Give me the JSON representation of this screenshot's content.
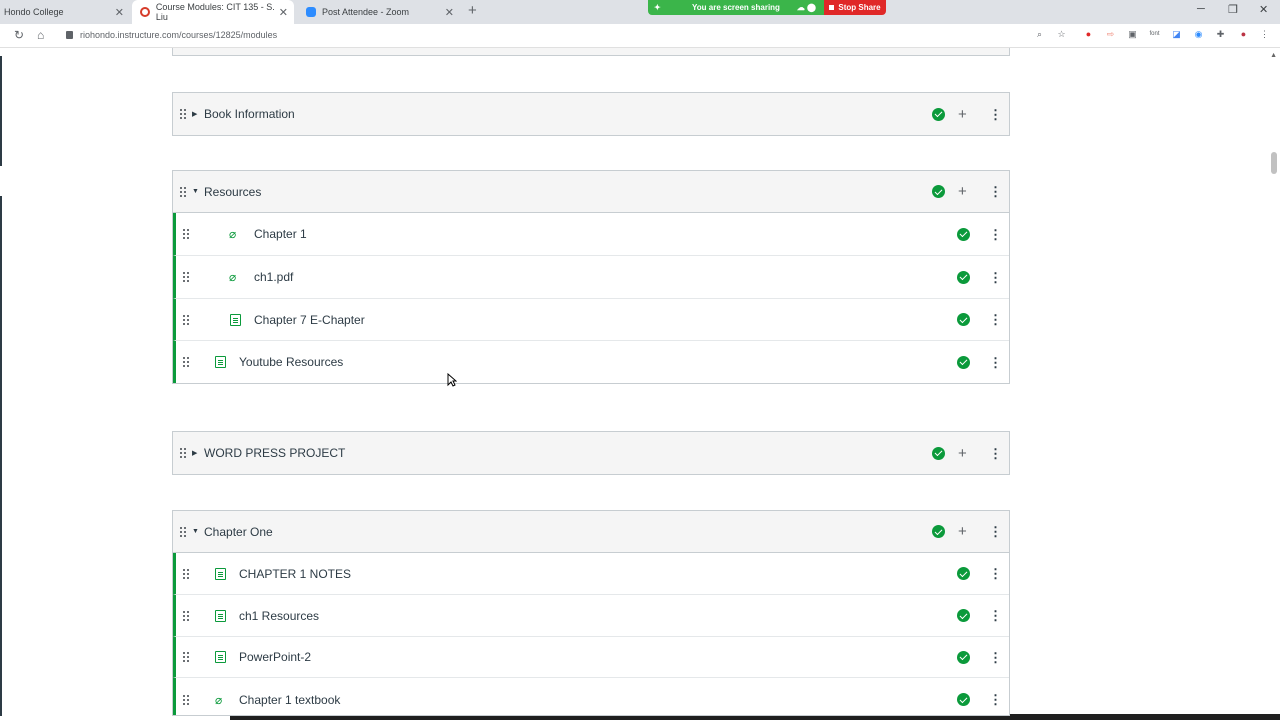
{
  "browser": {
    "tabs": [
      {
        "label": "Hondo College"
      },
      {
        "label": "Course Modules: CIT 135 - S. Liu"
      },
      {
        "label": "Post Attendee - Zoom"
      }
    ],
    "url": "riohondo.instructure.com/courses/12825/modules",
    "screen_share": {
      "status": "You are screen sharing",
      "stop_label": "Stop Share"
    }
  },
  "modules": [
    {
      "title": "Book Information",
      "expanded": false,
      "published": true
    },
    {
      "title": "Resources",
      "expanded": true,
      "published": true,
      "items": [
        {
          "title": "Chapter 1",
          "type": "attachment",
          "indent": 1
        },
        {
          "title": "ch1.pdf",
          "type": "attachment",
          "indent": 1
        },
        {
          "title": "Chapter 7 E-Chapter",
          "type": "page",
          "indent": 1
        },
        {
          "title": "Youtube Resources",
          "type": "page",
          "indent": 0
        }
      ]
    },
    {
      "title": "WORD PRESS PROJECT",
      "expanded": false,
      "published": true
    },
    {
      "title": "Chapter One",
      "expanded": true,
      "published": true,
      "items": [
        {
          "title": "CHAPTER 1 NOTES",
          "type": "page",
          "indent": 0
        },
        {
          "title": "ch1 Resources",
          "type": "page",
          "indent": 0
        },
        {
          "title": "PowerPoint-2",
          "type": "page",
          "indent": 0
        },
        {
          "title": "Chapter 1 textbook",
          "type": "attachment",
          "indent": 0
        }
      ]
    }
  ],
  "colors": {
    "published": "#0b9a3b",
    "module_border": "#c7cdd1",
    "header_bg": "#f5f5f5"
  }
}
